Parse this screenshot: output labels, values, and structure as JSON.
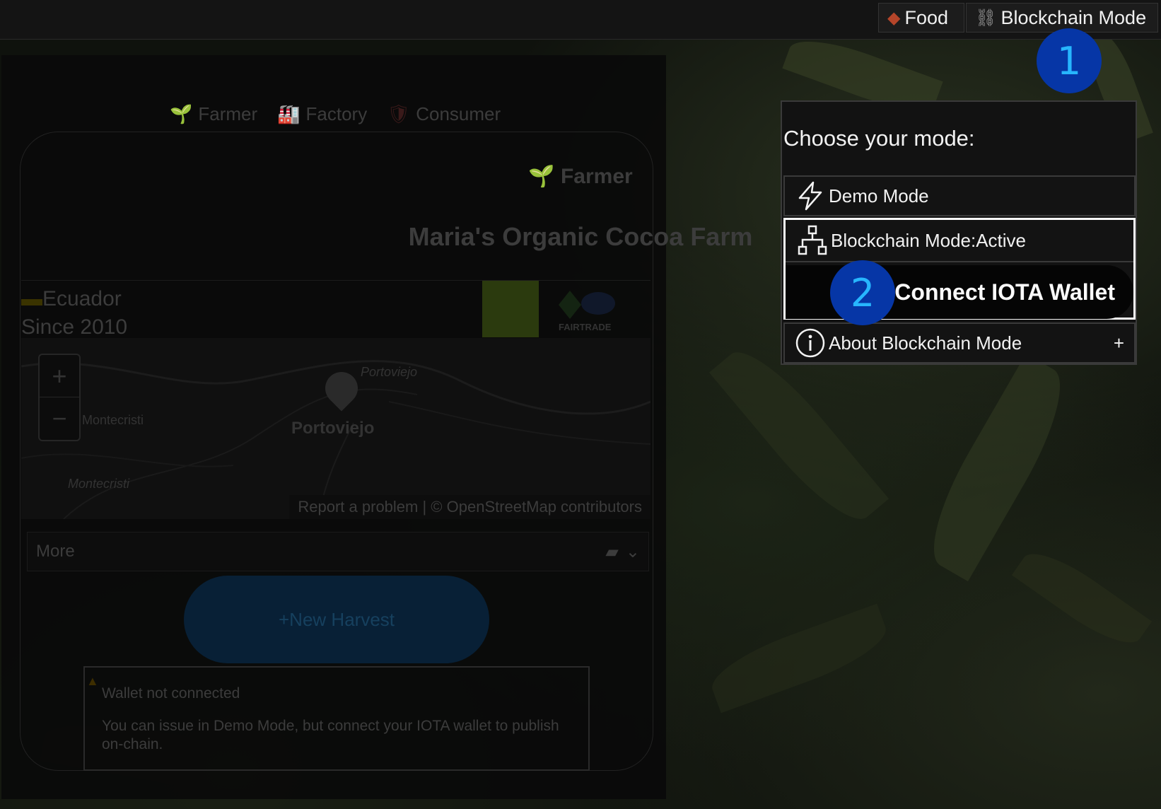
{
  "topbar": {
    "food_label": "Food",
    "food_icon": "chocolate-bar-icon",
    "blockchain_label": "Blockchain Mode",
    "blockchain_icon": "chain-link-icon"
  },
  "tabs": [
    {
      "label": "Farmer",
      "icon": "seedling-icon"
    },
    {
      "label": "Factory",
      "icon": "factory-icon"
    },
    {
      "label": "Consumer",
      "icon": "shield-icon"
    }
  ],
  "card": {
    "title": "Farmer",
    "farm_name": "Maria's Organic Cocoa Farm",
    "country": "Ecuador",
    "since": "Since 2010",
    "certification": "FAIRTRADE"
  },
  "map": {
    "labels": [
      "Portoviejo",
      "Montecristi",
      "Montecristi"
    ],
    "city": "Portoviejo",
    "zoom_in": "+",
    "zoom_out": "−",
    "attribution": "Report a problem | © OpenStreetMap contributors"
  },
  "more": {
    "label": "More"
  },
  "harvest": {
    "label": "+New Harvest"
  },
  "warning": {
    "title": "Wallet not connected",
    "body": "You can issue in Demo Mode, but connect your IOTA wallet to publish on-chain."
  },
  "mode_menu": {
    "title": "Choose your mode:",
    "demo_label": "Demo Mode",
    "blockchain_label": "Blockchain Mode:Active",
    "connect_label": "Connect IOTA Wallet",
    "about_label": "About Blockchain Mode",
    "about_toggle": "+"
  },
  "markers": {
    "first": "1",
    "second": "2"
  },
  "colors": {
    "marker_bg": "#0636a6",
    "marker_text": "#27b6ff",
    "active_border": "#fafafa"
  }
}
